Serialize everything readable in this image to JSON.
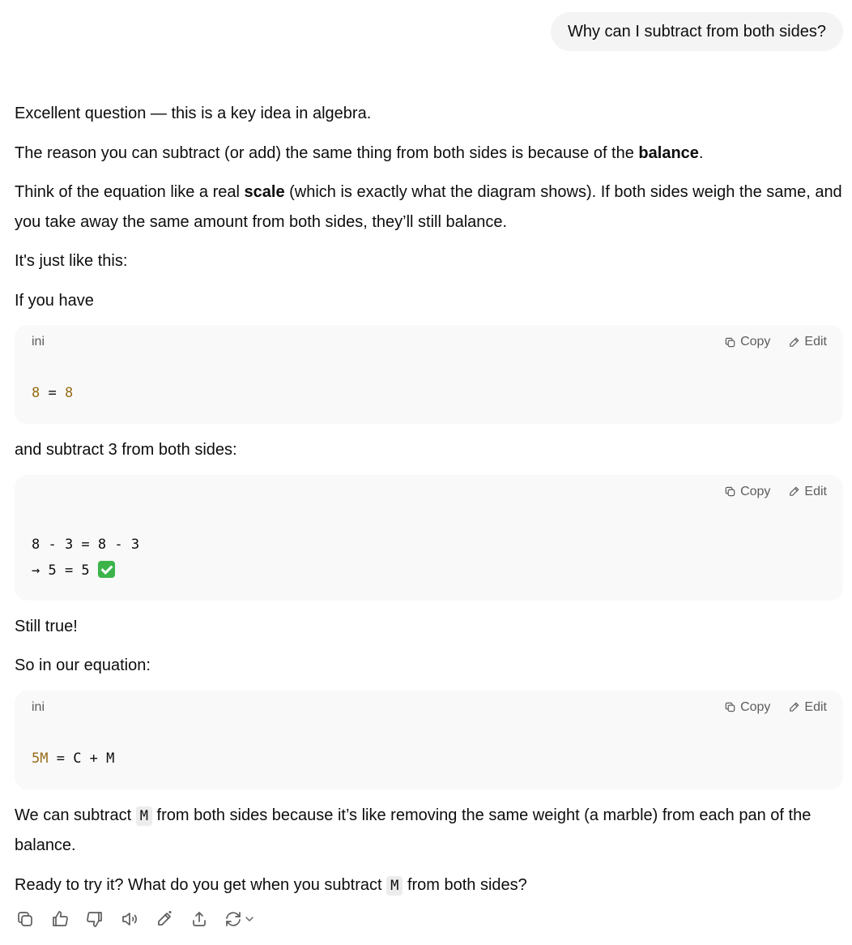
{
  "user_message": "Why can I subtract from both sides?",
  "assistant": {
    "p1": "Excellent question — this is a key idea in algebra.",
    "p2_before": "The reason you can subtract (or add) the same thing from both sides is because of the ",
    "p2_bold": "balance",
    "p2_after": ".",
    "p3_before": "Think of the equation like a real ",
    "p3_bold": "scale",
    "p3_after": " (which is exactly what the diagram shows). If both sides weigh the same, and you take away the same amount from both sides, they’ll still balance.",
    "p4": "It's just like this:",
    "p5": "If you have",
    "code1": {
      "lang": "ini",
      "left": "8",
      "eq": " = ",
      "right": "8"
    },
    "p6": "and subtract 3 from both sides:",
    "code2": {
      "lang": "",
      "line1": "8 - 3 = 8 - 3",
      "line2": "→ 5 = 5 "
    },
    "p7": "Still true!",
    "p8": "So in our equation:",
    "code3": {
      "lang": "ini",
      "key": "5M",
      "rest": " = C + M"
    },
    "p9_before": "We can subtract ",
    "p9_code": "M",
    "p9_after": " from both sides because it’s like removing the same weight (a marble) from each pan of the balance.",
    "p10_before": "Ready to try it? What do you get when you subtract ",
    "p10_code": "M",
    "p10_after": " from both sides?"
  },
  "code_actions": {
    "copy": "Copy",
    "edit": "Edit"
  },
  "toolbar_icons": [
    "copy-icon",
    "thumbs-up-icon",
    "thumbs-down-icon",
    "read-aloud-icon",
    "edit-canvas-icon",
    "share-icon",
    "regenerate-icon"
  ]
}
